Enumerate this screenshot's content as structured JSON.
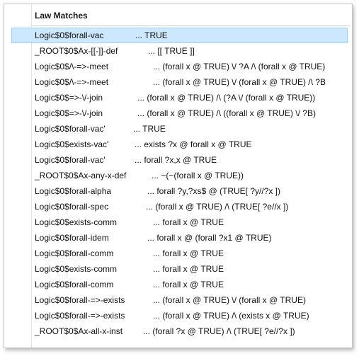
{
  "panel": {
    "header": "Law Matches"
  },
  "rows": [
    {
      "name": "Logic$0$forall-vac",
      "expr": "...  TRUE",
      "selected": true
    },
    {
      "name": "_ROOT$0$Ax-[[-]]-def",
      "expr": "...  [[ TRUE ]]"
    },
    {
      "name": "Logic$0$/\\-=>-meet",
      "expr": "...  (forall x @ TRUE) \\/ ?A /\\ (forall x @ TRUE)"
    },
    {
      "name": "Logic$0$/\\-=>-meet",
      "expr": "...  (forall x @ TRUE) \\/ (forall x @ TRUE) /\\ ?B"
    },
    {
      "name": "Logic$0$=>-\\/-join",
      "expr": "...  (forall x @ TRUE) /\\ (?A \\/ (forall x @ TRUE))"
    },
    {
      "name": "Logic$0$=>-\\/-join",
      "expr": "...  (forall x @ TRUE) /\\ ((forall x @ TRUE) \\/ ?B)"
    },
    {
      "name": "Logic$0$forall-vac'",
      "expr": "...  TRUE"
    },
    {
      "name": "Logic$0$exists-vac'",
      "expr": "...  exists ?x @ forall x @ TRUE"
    },
    {
      "name": "Logic$0$forall-vac'",
      "expr": "...  forall ?x,x @ TRUE"
    },
    {
      "name": "_ROOT$0$Ax-any-x-def",
      "expr": "...  ~(~(forall x @ TRUE))"
    },
    {
      "name": "Logic$0$forall-alpha",
      "expr": "...  forall ?y,?xs$ @ (TRUE[ ?y//?x ])"
    },
    {
      "name": "Logic$0$forall-spec",
      "expr": "...  (forall x @ TRUE) /\\ (TRUE[ ?e//x ])"
    },
    {
      "name": "Logic$0$exists-comm",
      "expr": "...  forall x @ TRUE"
    },
    {
      "name": "Logic$0$forall-idem",
      "expr": "...  forall x @ (forall ?x1 @ TRUE)"
    },
    {
      "name": "Logic$0$forall-comm",
      "expr": "...  forall x @ TRUE"
    },
    {
      "name": "Logic$0$exists-comm",
      "expr": "...  forall x @ TRUE"
    },
    {
      "name": "Logic$0$forall-comm",
      "expr": "...  forall x @ TRUE"
    },
    {
      "name": "Logic$0$forall-=>-exists",
      "expr": "...  (forall x @ TRUE) \\/ (forall x @ TRUE)"
    },
    {
      "name": "Logic$0$forall-=>-exists",
      "expr": "...  (forall x @ TRUE) /\\ (exists x @ TRUE)"
    },
    {
      "name": "_ROOT$0$Ax-all-x-inst",
      "expr": "...  (forall ?x @ TRUE) /\\ (TRUE[ ?e//?x ])"
    }
  ]
}
